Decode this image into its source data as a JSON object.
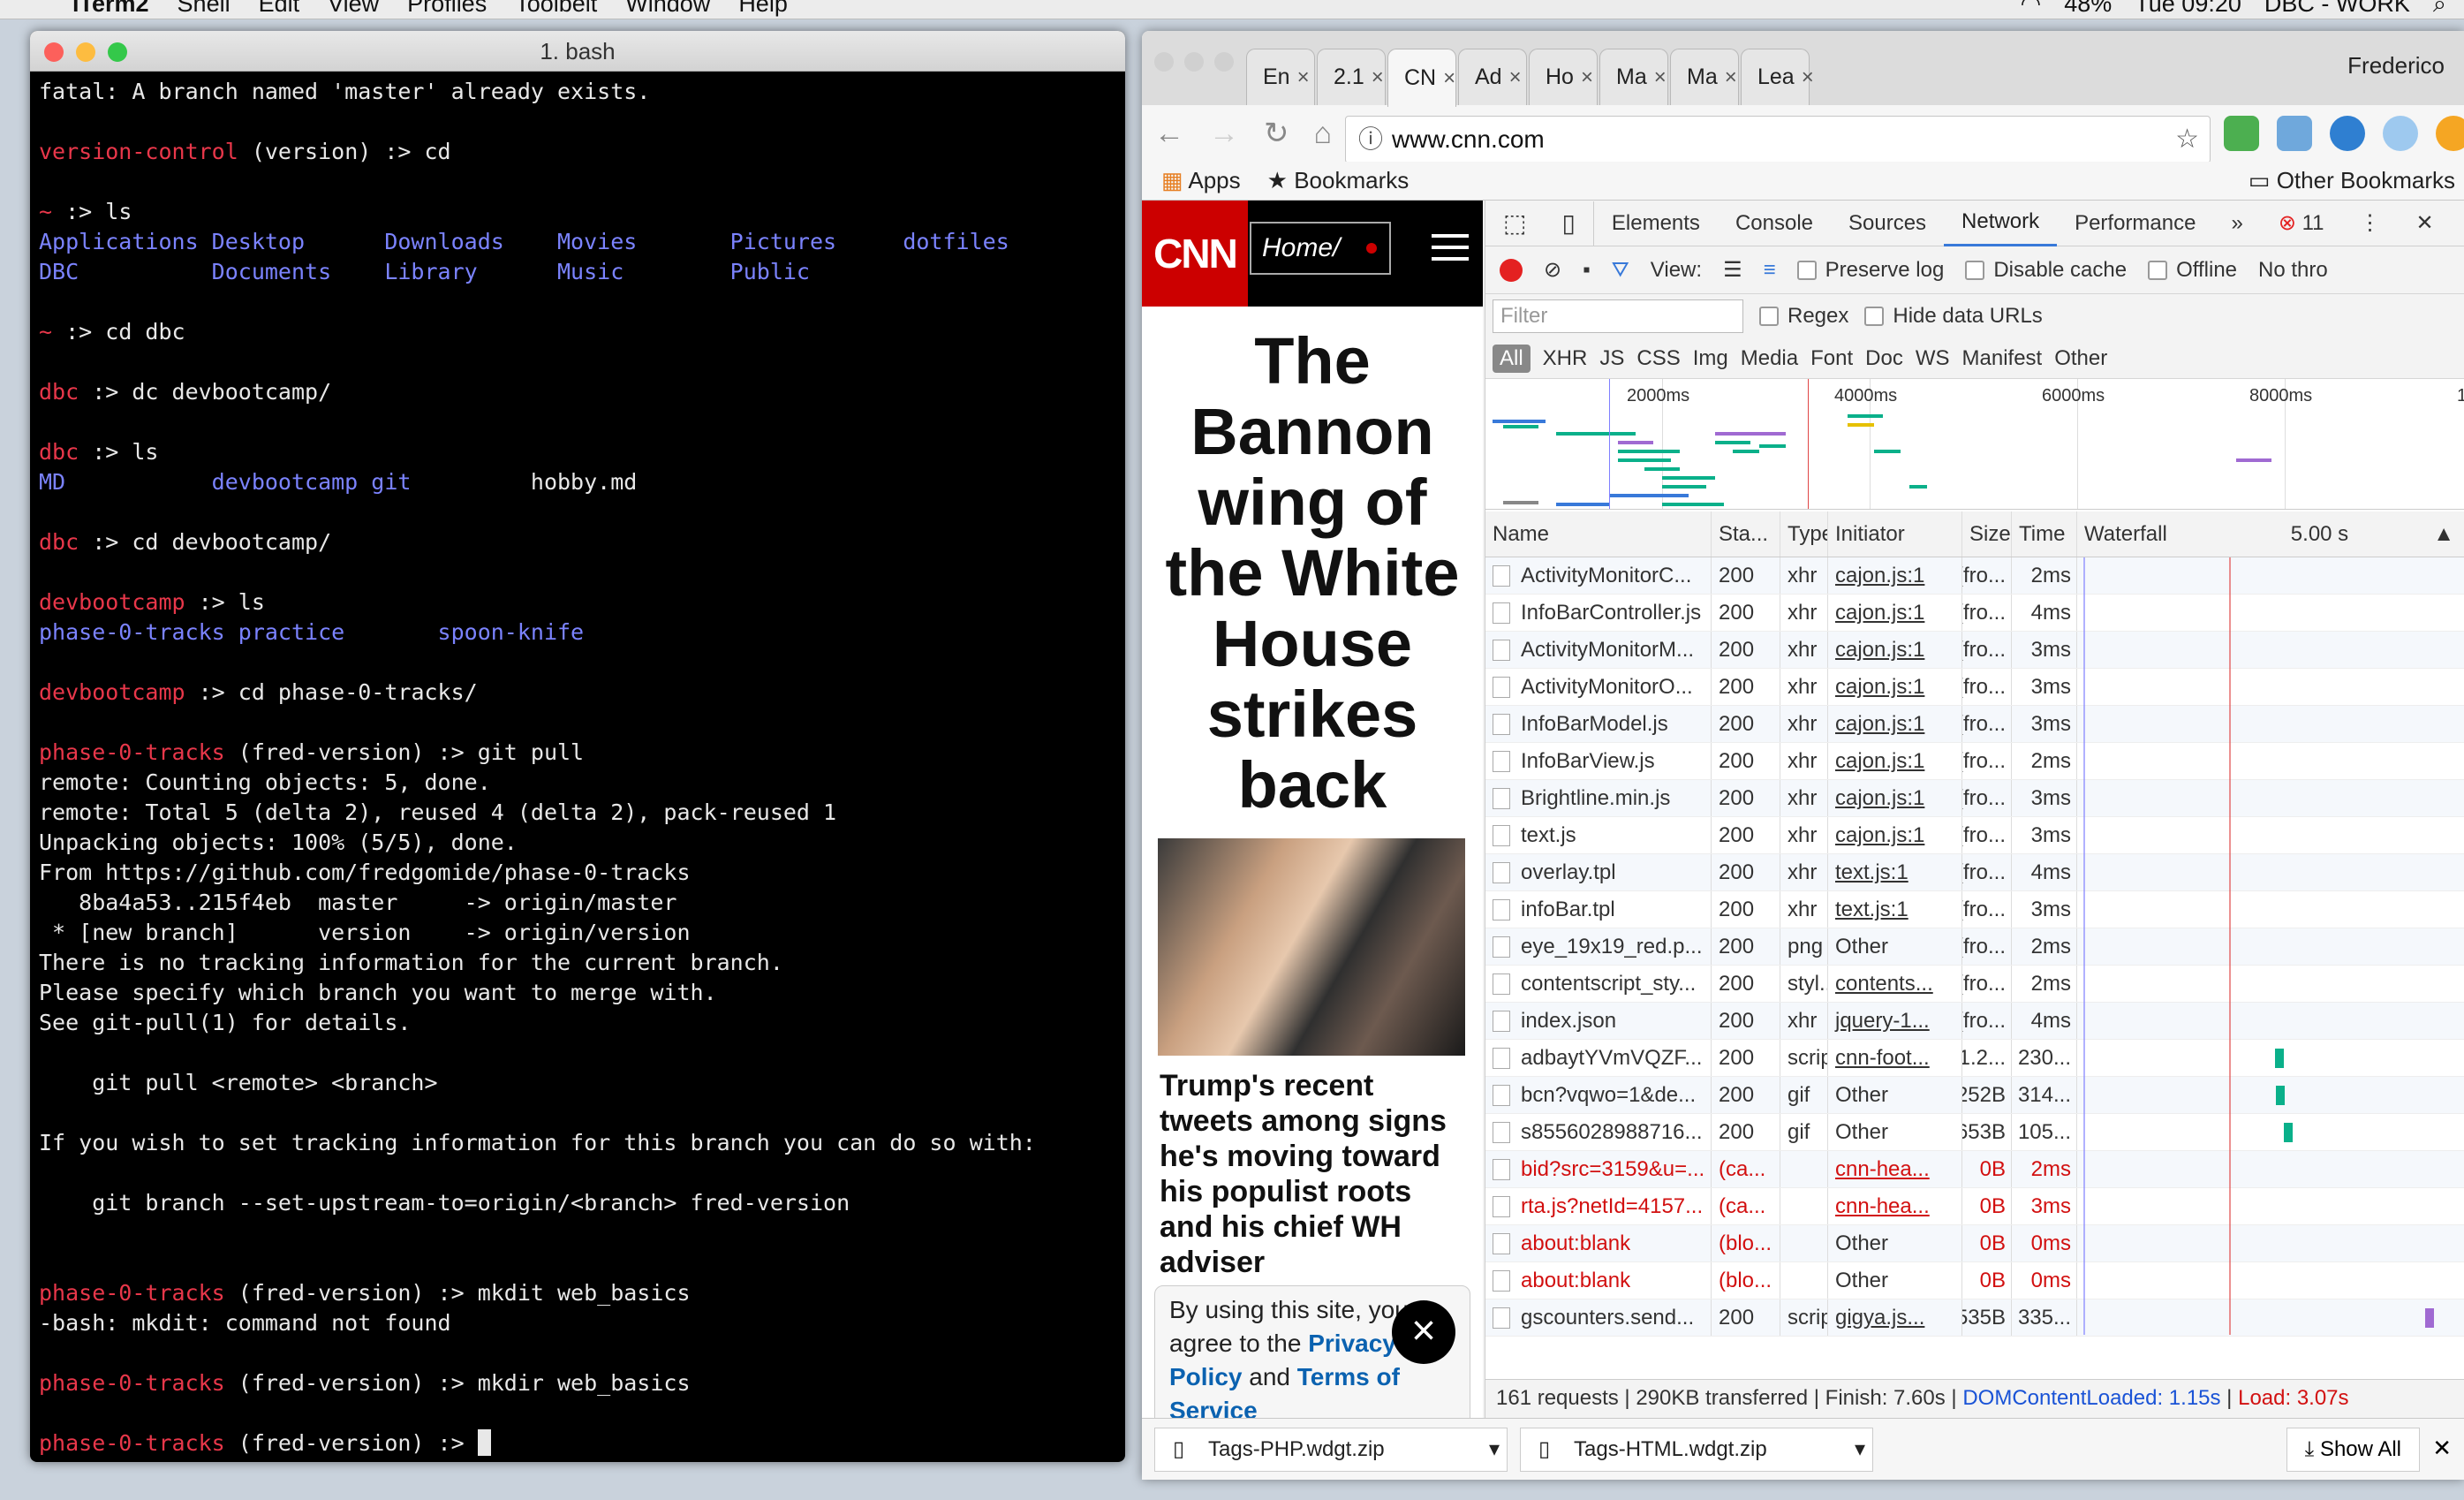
{
  "menubar": {
    "app": "iTerm2",
    "items": [
      "Shell",
      "Edit",
      "View",
      "Profiles",
      "Toolbelt",
      "Window",
      "Help"
    ],
    "battery": "48%",
    "clock": "Tue 09:20",
    "profile": "DBC - WORK"
  },
  "terminal": {
    "title": "1. bash",
    "lines": [
      [
        [
          "fatal: A branch named 'master' already exists.",
          ""
        ]
      ],
      [
        [
          "",
          ""
        ]
      ],
      [
        [
          "version-control",
          "r"
        ],
        [
          " (version) :> cd",
          ""
        ]
      ],
      [
        [
          "",
          ""
        ]
      ],
      [
        [
          "~",
          "r"
        ],
        [
          " :> ls",
          ""
        ]
      ],
      [
        [
          "Applications Desktop      Downloads    Movies       Pictures     dotfiles",
          "b"
        ]
      ],
      [
        [
          "DBC          Documents    Library      Music        Public",
          "b"
        ]
      ],
      [
        [
          "",
          ""
        ]
      ],
      [
        [
          "~",
          "r"
        ],
        [
          " :> cd dbc",
          ""
        ]
      ],
      [
        [
          "",
          ""
        ]
      ],
      [
        [
          "dbc",
          "r"
        ],
        [
          " :> dc devbootcamp/",
          ""
        ]
      ],
      [
        [
          "",
          ""
        ]
      ],
      [
        [
          "dbc",
          "r"
        ],
        [
          " :> ls",
          ""
        ]
      ],
      [
        [
          "MD           devbootcamp git",
          "b"
        ],
        [
          "         hobby.md",
          ""
        ]
      ],
      [
        [
          "",
          ""
        ]
      ],
      [
        [
          "dbc",
          "r"
        ],
        [
          " :> cd devbootcamp/",
          ""
        ]
      ],
      [
        [
          "",
          ""
        ]
      ],
      [
        [
          "devbootcamp",
          "r"
        ],
        [
          " :> ls",
          ""
        ]
      ],
      [
        [
          "phase-0-tracks practice       spoon-knife",
          "b"
        ]
      ],
      [
        [
          "",
          ""
        ]
      ],
      [
        [
          "devbootcamp",
          "r"
        ],
        [
          " :> cd phase-0-tracks/",
          ""
        ]
      ],
      [
        [
          "",
          ""
        ]
      ],
      [
        [
          "phase-0-tracks",
          "r"
        ],
        [
          " (fred-version) :> git pull",
          ""
        ]
      ],
      [
        [
          "remote: Counting objects: 5, done.",
          ""
        ]
      ],
      [
        [
          "remote: Total 5 (delta 2), reused 4 (delta 2), pack-reused 1",
          ""
        ]
      ],
      [
        [
          "Unpacking objects: 100% (5/5), done.",
          ""
        ]
      ],
      [
        [
          "From https://github.com/fredgomide/phase-0-tracks",
          ""
        ]
      ],
      [
        [
          "   8ba4a53..215f4eb  master     -> origin/master",
          ""
        ]
      ],
      [
        [
          " * [new branch]      version    -> origin/version",
          ""
        ]
      ],
      [
        [
          "There is no tracking information for the current branch.",
          ""
        ]
      ],
      [
        [
          "Please specify which branch you want to merge with.",
          ""
        ]
      ],
      [
        [
          "See git-pull(1) for details.",
          ""
        ]
      ],
      [
        [
          "",
          ""
        ]
      ],
      [
        [
          "    git pull <remote> <branch>",
          ""
        ]
      ],
      [
        [
          "",
          ""
        ]
      ],
      [
        [
          "If you wish to set tracking information for this branch you can do so with:",
          ""
        ]
      ],
      [
        [
          "",
          ""
        ]
      ],
      [
        [
          "    git branch --set-upstream-to=origin/<branch> fred-version",
          ""
        ]
      ],
      [
        [
          "",
          ""
        ]
      ],
      [
        [
          "",
          ""
        ]
      ],
      [
        [
          "phase-0-tracks",
          "r"
        ],
        [
          " (fred-version) :> mkdit web_basics",
          ""
        ]
      ],
      [
        [
          "-bash: mkdit: command not found",
          ""
        ]
      ],
      [
        [
          "",
          ""
        ]
      ],
      [
        [
          "phase-0-tracks",
          "r"
        ],
        [
          " (fred-version) :> mkdir web_basics",
          ""
        ]
      ],
      [
        [
          "",
          ""
        ]
      ],
      [
        [
          "phase-0-tracks",
          "r"
        ],
        [
          " (fred-version) :> ",
          ""
        ]
      ]
    ]
  },
  "chrome": {
    "tabs": [
      {
        "label": "En",
        "color": "#d93025"
      },
      {
        "label": "2.1",
        "color": "#d0312d"
      },
      {
        "label": "CN",
        "color": "#cc0000"
      },
      {
        "label": "Ad",
        "color": "#222"
      },
      {
        "label": "Ho",
        "color": "#d0312d"
      },
      {
        "label": "Ma",
        "color": "#5a6a80"
      },
      {
        "label": "Ma",
        "color": "#5a6a80"
      },
      {
        "label": "Lea",
        "color": "#3b5fa0"
      }
    ],
    "user": "Frederico",
    "url": "www.cnn.com",
    "bookmarks": {
      "apps": "Apps",
      "bookmarks": "Bookmarks",
      "other": "Other Bookmarks"
    }
  },
  "cnn": {
    "logo": "CNN",
    "home": "Home/",
    "headline": "The Bannon wing of the White House strikes back",
    "subhead": "Trump's recent tweets among signs he's moving toward his populist roots and his chief WH adviser",
    "consent": {
      "text": "By using this site, you agree to the",
      "privacy": "Privacy Policy",
      "and": "and",
      "terms": "Terms of Service"
    }
  },
  "devtools": {
    "tabs": [
      "Elements",
      "Console",
      "Sources",
      "Network",
      "Performance"
    ],
    "more": "»",
    "errors": "11",
    "toolbar": {
      "view": "View:",
      "preserve": "Preserve log",
      "cache": "Disable cache",
      "offline": "Offline",
      "throttle": "No thro"
    },
    "filter": {
      "placeholder": "Filter",
      "regex": "Regex",
      "hide": "Hide data URLs"
    },
    "types": [
      "All",
      "XHR",
      "JS",
      "CSS",
      "Img",
      "Media",
      "Font",
      "Doc",
      "WS",
      "Manifest",
      "Other"
    ],
    "ticks": [
      "2000ms",
      "4000ms",
      "6000ms",
      "8000ms",
      "1"
    ],
    "headers": [
      "Name",
      "Sta...",
      "Type",
      "Initiator",
      "Size",
      "Time",
      "Waterfall"
    ],
    "waterfall_time": "5.00 s",
    "rows": [
      [
        "ActivityMonitorC...",
        "200",
        "xhr",
        "cajon.js:1",
        "(fro...",
        "2ms"
      ],
      [
        "InfoBarController.js",
        "200",
        "xhr",
        "cajon.js:1",
        "(fro...",
        "4ms"
      ],
      [
        "ActivityMonitorM...",
        "200",
        "xhr",
        "cajon.js:1",
        "(fro...",
        "3ms"
      ],
      [
        "ActivityMonitorO...",
        "200",
        "xhr",
        "cajon.js:1",
        "(fro...",
        "3ms"
      ],
      [
        "InfoBarModel.js",
        "200",
        "xhr",
        "cajon.js:1",
        "(fro...",
        "3ms"
      ],
      [
        "InfoBarView.js",
        "200",
        "xhr",
        "cajon.js:1",
        "(fro...",
        "2ms"
      ],
      [
        "Brightline.min.js",
        "200",
        "xhr",
        "cajon.js:1",
        "(fro...",
        "3ms"
      ],
      [
        "text.js",
        "200",
        "xhr",
        "cajon.js:1",
        "(fro...",
        "3ms"
      ],
      [
        "overlay.tpl",
        "200",
        "xhr",
        "text.js:1",
        "(fro...",
        "4ms"
      ],
      [
        "infoBar.tpl",
        "200",
        "xhr",
        "text.js:1",
        "(fro...",
        "3ms"
      ],
      [
        "eye_19x19_red.p...",
        "200",
        "png",
        "Other",
        "(fro...",
        "2ms"
      ],
      [
        "contentscript_sty...",
        "200",
        "styl...",
        "contents...",
        "(fro...",
        "2ms"
      ],
      [
        "index.json",
        "200",
        "xhr",
        "jquery-1...",
        "(fro...",
        "4ms"
      ],
      [
        "adbaytYVmVQZF...",
        "200",
        "script",
        "cnn-foot...",
        "1.2...",
        "230..."
      ],
      [
        "bcn?vqwo=1&de...",
        "200",
        "gif",
        "Other",
        "252B",
        "314..."
      ],
      [
        "s8556028988716...",
        "200",
        "gif",
        "Other",
        "653B",
        "105..."
      ],
      [
        "bid?src=3159&u=...",
        "(ca...",
        "",
        "cnn-hea...",
        "0B",
        "2ms"
      ],
      [
        "rta.js?netId=4157...",
        "(ca...",
        "",
        "cnn-hea...",
        "0B",
        "3ms"
      ],
      [
        "about:blank",
        "(blo...",
        "",
        "Other",
        "0B",
        "0ms"
      ],
      [
        "about:blank",
        "(blo...",
        "",
        "Other",
        "0B",
        "0ms"
      ],
      [
        "gscounters.send...",
        "200",
        "script",
        "gigya.js...",
        "535B",
        "335..."
      ]
    ],
    "status": {
      "summary": "161 requests | 290KB transferred | Finish: 7.60s | ",
      "dcl": "DOMContentLoaded: 1.15s",
      "sep": " | ",
      "load": "Load: 3.07s"
    }
  },
  "downloads": {
    "items": [
      "Tags-PHP.wdgt.zip",
      "Tags-HTML.wdgt.zip"
    ],
    "showall": "Show All"
  }
}
